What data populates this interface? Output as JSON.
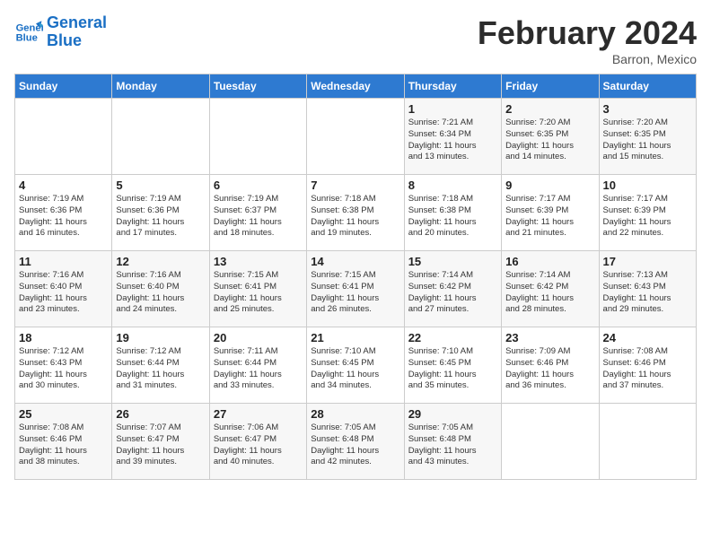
{
  "header": {
    "logo_line1": "General",
    "logo_line2": "Blue",
    "month_title": "February 2024",
    "subtitle": "Barron, Mexico"
  },
  "weekdays": [
    "Sunday",
    "Monday",
    "Tuesday",
    "Wednesday",
    "Thursday",
    "Friday",
    "Saturday"
  ],
  "weeks": [
    [
      {
        "num": "",
        "info": ""
      },
      {
        "num": "",
        "info": ""
      },
      {
        "num": "",
        "info": ""
      },
      {
        "num": "",
        "info": ""
      },
      {
        "num": "1",
        "info": "Sunrise: 7:21 AM\nSunset: 6:34 PM\nDaylight: 11 hours\nand 13 minutes."
      },
      {
        "num": "2",
        "info": "Sunrise: 7:20 AM\nSunset: 6:35 PM\nDaylight: 11 hours\nand 14 minutes."
      },
      {
        "num": "3",
        "info": "Sunrise: 7:20 AM\nSunset: 6:35 PM\nDaylight: 11 hours\nand 15 minutes."
      }
    ],
    [
      {
        "num": "4",
        "info": "Sunrise: 7:19 AM\nSunset: 6:36 PM\nDaylight: 11 hours\nand 16 minutes."
      },
      {
        "num": "5",
        "info": "Sunrise: 7:19 AM\nSunset: 6:36 PM\nDaylight: 11 hours\nand 17 minutes."
      },
      {
        "num": "6",
        "info": "Sunrise: 7:19 AM\nSunset: 6:37 PM\nDaylight: 11 hours\nand 18 minutes."
      },
      {
        "num": "7",
        "info": "Sunrise: 7:18 AM\nSunset: 6:38 PM\nDaylight: 11 hours\nand 19 minutes."
      },
      {
        "num": "8",
        "info": "Sunrise: 7:18 AM\nSunset: 6:38 PM\nDaylight: 11 hours\nand 20 minutes."
      },
      {
        "num": "9",
        "info": "Sunrise: 7:17 AM\nSunset: 6:39 PM\nDaylight: 11 hours\nand 21 minutes."
      },
      {
        "num": "10",
        "info": "Sunrise: 7:17 AM\nSunset: 6:39 PM\nDaylight: 11 hours\nand 22 minutes."
      }
    ],
    [
      {
        "num": "11",
        "info": "Sunrise: 7:16 AM\nSunset: 6:40 PM\nDaylight: 11 hours\nand 23 minutes."
      },
      {
        "num": "12",
        "info": "Sunrise: 7:16 AM\nSunset: 6:40 PM\nDaylight: 11 hours\nand 24 minutes."
      },
      {
        "num": "13",
        "info": "Sunrise: 7:15 AM\nSunset: 6:41 PM\nDaylight: 11 hours\nand 25 minutes."
      },
      {
        "num": "14",
        "info": "Sunrise: 7:15 AM\nSunset: 6:41 PM\nDaylight: 11 hours\nand 26 minutes."
      },
      {
        "num": "15",
        "info": "Sunrise: 7:14 AM\nSunset: 6:42 PM\nDaylight: 11 hours\nand 27 minutes."
      },
      {
        "num": "16",
        "info": "Sunrise: 7:14 AM\nSunset: 6:42 PM\nDaylight: 11 hours\nand 28 minutes."
      },
      {
        "num": "17",
        "info": "Sunrise: 7:13 AM\nSunset: 6:43 PM\nDaylight: 11 hours\nand 29 minutes."
      }
    ],
    [
      {
        "num": "18",
        "info": "Sunrise: 7:12 AM\nSunset: 6:43 PM\nDaylight: 11 hours\nand 30 minutes."
      },
      {
        "num": "19",
        "info": "Sunrise: 7:12 AM\nSunset: 6:44 PM\nDaylight: 11 hours\nand 31 minutes."
      },
      {
        "num": "20",
        "info": "Sunrise: 7:11 AM\nSunset: 6:44 PM\nDaylight: 11 hours\nand 33 minutes."
      },
      {
        "num": "21",
        "info": "Sunrise: 7:10 AM\nSunset: 6:45 PM\nDaylight: 11 hours\nand 34 minutes."
      },
      {
        "num": "22",
        "info": "Sunrise: 7:10 AM\nSunset: 6:45 PM\nDaylight: 11 hours\nand 35 minutes."
      },
      {
        "num": "23",
        "info": "Sunrise: 7:09 AM\nSunset: 6:46 PM\nDaylight: 11 hours\nand 36 minutes."
      },
      {
        "num": "24",
        "info": "Sunrise: 7:08 AM\nSunset: 6:46 PM\nDaylight: 11 hours\nand 37 minutes."
      }
    ],
    [
      {
        "num": "25",
        "info": "Sunrise: 7:08 AM\nSunset: 6:46 PM\nDaylight: 11 hours\nand 38 minutes."
      },
      {
        "num": "26",
        "info": "Sunrise: 7:07 AM\nSunset: 6:47 PM\nDaylight: 11 hours\nand 39 minutes."
      },
      {
        "num": "27",
        "info": "Sunrise: 7:06 AM\nSunset: 6:47 PM\nDaylight: 11 hours\nand 40 minutes."
      },
      {
        "num": "28",
        "info": "Sunrise: 7:05 AM\nSunset: 6:48 PM\nDaylight: 11 hours\nand 42 minutes."
      },
      {
        "num": "29",
        "info": "Sunrise: 7:05 AM\nSunset: 6:48 PM\nDaylight: 11 hours\nand 43 minutes."
      },
      {
        "num": "",
        "info": ""
      },
      {
        "num": "",
        "info": ""
      }
    ]
  ]
}
